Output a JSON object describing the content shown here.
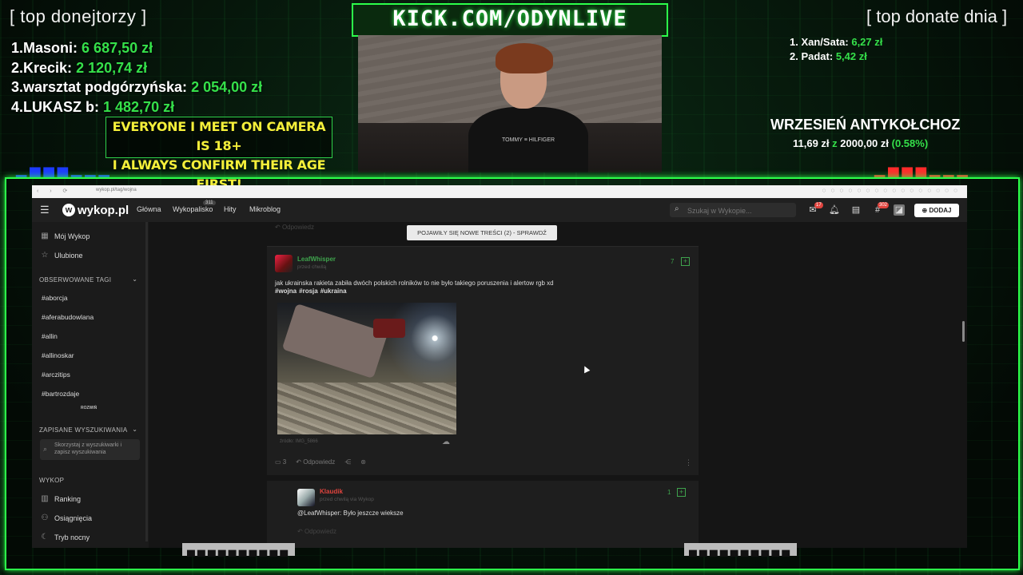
{
  "overlay": {
    "top_donors_title": "[ top donejtorzy ]",
    "top_donors": [
      {
        "rank": "1.",
        "name": "Masoni:",
        "amount": "6 687,50 zł"
      },
      {
        "rank": "2.",
        "name": "Krecik:",
        "amount": "2 120,74 zł"
      },
      {
        "rank": "3.",
        "name": "warsztat podgórzyńska:",
        "amount": "2 054,00 zł"
      },
      {
        "rank": "4.",
        "name": "LUKASZ b:",
        "amount": "1 482,70 zł"
      }
    ],
    "warning_lines": [
      "EVERYONE I MEET ON CAMERA IS 18+",
      "I ALWAYS CONFIRM THEIR AGE FIRST!"
    ],
    "kick_banner": "KICK.COM/ODYNLIVE",
    "top_donate_today_title": "[ top donate dnia ]",
    "top_donate_today": [
      {
        "rank": "1.",
        "name": "Xan/Sata:",
        "amount": "6,27 zł"
      },
      {
        "rank": "2.",
        "name": "Padat:",
        "amount": "5,42 zł"
      }
    ],
    "goal": {
      "title": "WRZESIEŃ ANTYKOŁCHOZ",
      "current": "11,69 zł",
      "separator": "z",
      "target": "2000,00 zł",
      "percent": "(0.58%)"
    },
    "shirt_text": "TOMMY ≡ HILFIGER",
    "accent_color": "#35e04a"
  },
  "browser": {
    "url": "wykop.pl/tag/wojna",
    "nav": {
      "logo": "wykop.pl",
      "links": [
        "Główna",
        "Wykopalisko",
        "Hity",
        "Mikroblog"
      ],
      "wykopalisko_badge": "311",
      "search_placeholder": "Szukaj w Wykopie...",
      "mail_badge": "17",
      "tags_badge": "302",
      "add_label": "DODAJ"
    },
    "sidebar": {
      "top_items": [
        "Mój Wykop",
        "Ulubione"
      ],
      "observed_tags_header": "OBSERWOWANE TAGI",
      "tags": [
        "#aborcja",
        "#aferabudowlana",
        "#allin",
        "#allinoskar",
        "#arczitips",
        "#bartrozdaje"
      ],
      "expand_label": "ROZWIŃ",
      "saved_searches_header": "ZAPISANE WYSZUKIWANIA",
      "saved_searches_hint": "Skorzystaj z wyszukiwarki i zapisz wyszukiwania",
      "wykop_header": "WYKOP",
      "wykop_items": [
        "Ranking",
        "Osiągnięcia",
        "Tryb nocny"
      ]
    },
    "feed": {
      "new_content_pill": "POJAWIŁY SIĘ NOWE TREŚCI (2) - SPRAWDŹ",
      "ghost_reply": "Odpowiedz",
      "post": {
        "author": "LeafWhisper",
        "time": "przed chwilą",
        "votes": "7",
        "text": "jak ukrainska rakieta zabiła dwóch polskich rolników to nie było takiego poruszenia i alertow rgb xd",
        "tags": [
          "#wojna",
          "#rosja",
          "#ukraina"
        ],
        "source": "źródło: IMG_5866",
        "comments_count": "3",
        "reply_label": "Odpowiedz"
      },
      "comment": {
        "author": "Klaudik",
        "time": "przed chwilą  via Wykop",
        "votes": "1",
        "text": "@LeafWhisper: Było jeszcze wieksze",
        "reply_label": "Odpowiedz"
      }
    }
  }
}
